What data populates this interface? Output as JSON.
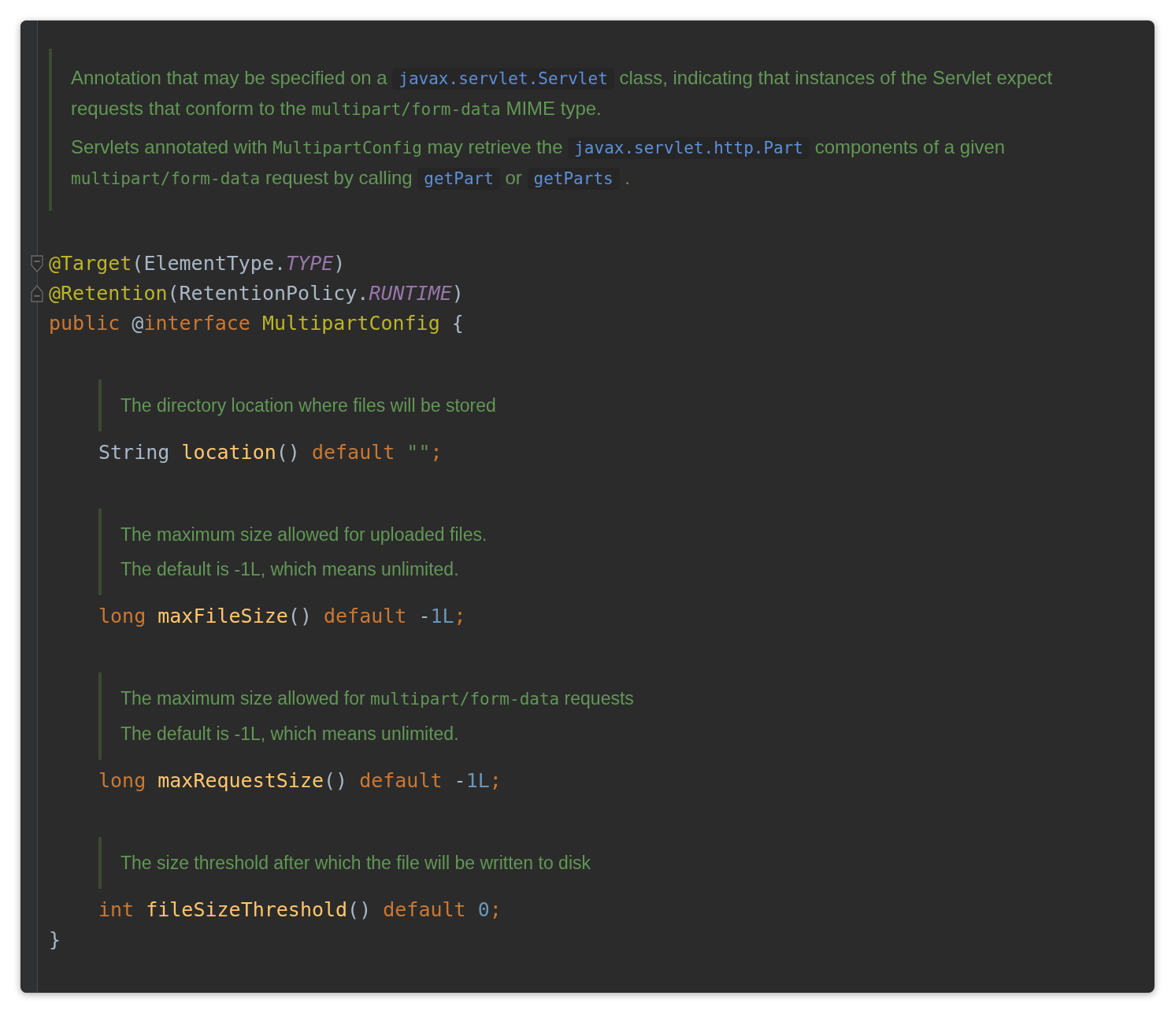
{
  "class_doc": {
    "paragraphs": [
      {
        "runs": [
          {
            "kind": "text",
            "text": "Annotation that may be specified on a "
          },
          {
            "kind": "link",
            "text": "javax.servlet.Servlet"
          },
          {
            "kind": "text",
            "text": " class, indicating that instances of the Servlet expect requests that conform to the "
          },
          {
            "kind": "mono",
            "text": "multipart/form-data"
          },
          {
            "kind": "text",
            "text": " MIME type."
          }
        ]
      },
      {
        "runs": [
          {
            "kind": "text",
            "text": "Servlets annotated with "
          },
          {
            "kind": "mono",
            "text": "MultipartConfig"
          },
          {
            "kind": "text",
            "text": " may retrieve the "
          },
          {
            "kind": "link",
            "text": "javax.servlet.http.Part"
          },
          {
            "kind": "text",
            "text": " components of a given "
          },
          {
            "kind": "mono",
            "text": "multipart/form-data"
          },
          {
            "kind": "text",
            "text": " request by calling "
          },
          {
            "kind": "link",
            "text": "getPart"
          },
          {
            "kind": "text",
            "text": " or "
          },
          {
            "kind": "link",
            "text": "getParts"
          },
          {
            "kind": "text",
            "text": " ."
          }
        ]
      }
    ]
  },
  "declaration": [
    {
      "kind": "fold_start",
      "tokens": [
        {
          "kind": "annotation",
          "text": "@Target"
        },
        {
          "kind": "plain",
          "text": "(ElementType."
        },
        {
          "kind": "constant",
          "text": "TYPE"
        },
        {
          "kind": "plain",
          "text": ")"
        }
      ]
    },
    {
      "kind": "fold_end",
      "tokens": [
        {
          "kind": "annotation",
          "text": "@Retention"
        },
        {
          "kind": "plain",
          "text": "(RetentionPolicy."
        },
        {
          "kind": "constant",
          "text": "RUNTIME"
        },
        {
          "kind": "plain",
          "text": ")"
        }
      ]
    },
    {
      "kind": "plain",
      "tokens": [
        {
          "kind": "keyword",
          "text": "public "
        },
        {
          "kind": "plain",
          "text": "@"
        },
        {
          "kind": "keyword",
          "text": "interface "
        },
        {
          "kind": "annotation",
          "text": "MultipartConfig "
        },
        {
          "kind": "plain",
          "text": "{"
        }
      ]
    }
  ],
  "members": [
    {
      "doc": [
        {
          "runs": [
            {
              "kind": "text",
              "text": "The directory location where files will be stored"
            }
          ]
        }
      ],
      "tokens": [
        {
          "kind": "plain",
          "text": "String "
        },
        {
          "kind": "method",
          "text": "location"
        },
        {
          "kind": "plain",
          "text": "() "
        },
        {
          "kind": "keyword",
          "text": "default "
        },
        {
          "kind": "string",
          "text": "\"\""
        },
        {
          "kind": "keyword",
          "text": ";"
        }
      ]
    },
    {
      "doc": [
        {
          "runs": [
            {
              "kind": "text",
              "text": "The maximum size allowed for uploaded files."
            }
          ]
        },
        {
          "runs": [
            {
              "kind": "text",
              "text": "The default is -1L, which means unlimited."
            }
          ]
        }
      ],
      "tokens": [
        {
          "kind": "keyword",
          "text": "long "
        },
        {
          "kind": "method",
          "text": "maxFileSize"
        },
        {
          "kind": "plain",
          "text": "() "
        },
        {
          "kind": "keyword",
          "text": "default "
        },
        {
          "kind": "plain",
          "text": "-"
        },
        {
          "kind": "number",
          "text": "1L"
        },
        {
          "kind": "keyword",
          "text": ";"
        }
      ]
    },
    {
      "doc": [
        {
          "runs": [
            {
              "kind": "text",
              "text": "The maximum size allowed for "
            },
            {
              "kind": "mono",
              "text": "multipart/form-data"
            },
            {
              "kind": "text",
              "text": " requests"
            }
          ]
        },
        {
          "runs": [
            {
              "kind": "text",
              "text": "The default is -1L, which means unlimited."
            }
          ]
        }
      ],
      "tokens": [
        {
          "kind": "keyword",
          "text": "long "
        },
        {
          "kind": "method",
          "text": "maxRequestSize"
        },
        {
          "kind": "plain",
          "text": "() "
        },
        {
          "kind": "keyword",
          "text": "default "
        },
        {
          "kind": "plain",
          "text": "-"
        },
        {
          "kind": "number",
          "text": "1L"
        },
        {
          "kind": "keyword",
          "text": ";"
        }
      ]
    },
    {
      "doc": [
        {
          "runs": [
            {
              "kind": "text",
              "text": "The size threshold after which the file will be written to disk"
            }
          ]
        }
      ],
      "tokens": [
        {
          "kind": "keyword",
          "text": "int "
        },
        {
          "kind": "method",
          "text": "fileSizeThreshold"
        },
        {
          "kind": "plain",
          "text": "() "
        },
        {
          "kind": "keyword",
          "text": "default "
        },
        {
          "kind": "number",
          "text": "0"
        },
        {
          "kind": "keyword",
          "text": ";"
        }
      ]
    }
  ],
  "closing": {
    "tokens": [
      {
        "kind": "plain",
        "text": "}"
      }
    ]
  }
}
